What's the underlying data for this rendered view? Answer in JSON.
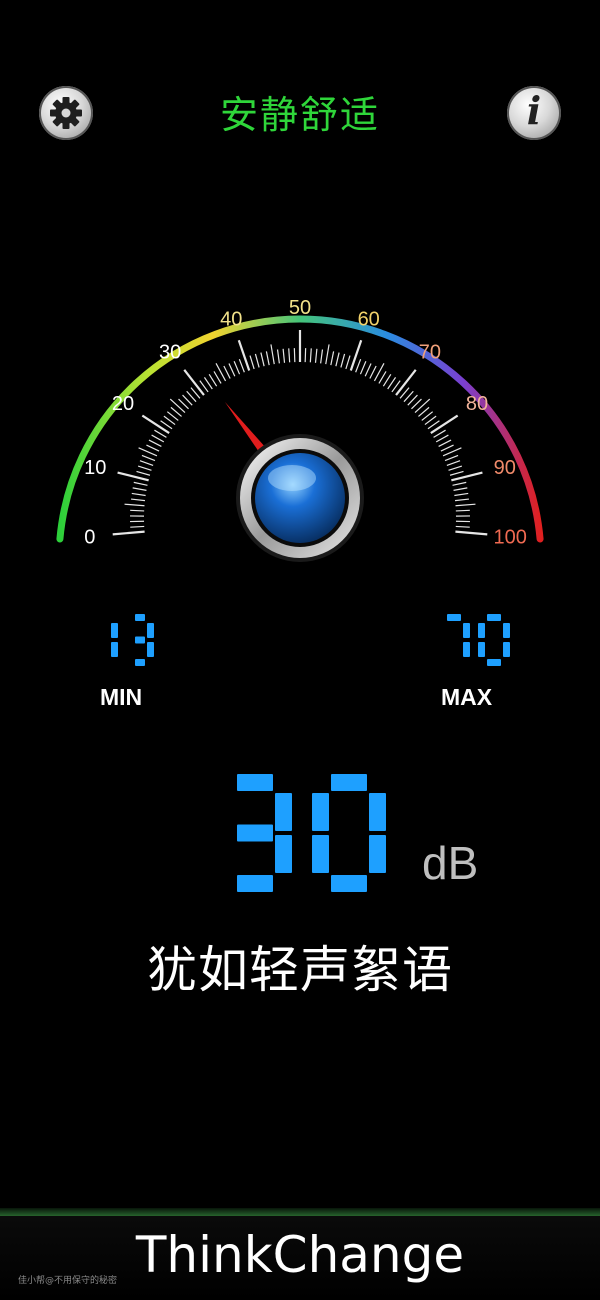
{
  "header": {
    "title": "安静舒适",
    "settings_icon": "gear-icon",
    "info_icon": "info-icon",
    "info_glyph": "i",
    "title_color": "#2fd63a"
  },
  "gauge": {
    "ticks": [
      "0",
      "10",
      "20",
      "30",
      "40",
      "50",
      "60",
      "70",
      "80",
      "90",
      "100"
    ],
    "range": [
      0,
      100
    ],
    "needle_value": 30,
    "needle_color": "#e11d1d",
    "hub_color": "#1a6fd6"
  },
  "readouts": {
    "min_value": "13",
    "min_label": "MIN",
    "max_value": "70",
    "max_label": "MAX",
    "current_value": "30",
    "unit": "dB",
    "lcd_color": "#1ea0ff"
  },
  "description": "犹如轻声絮语",
  "footer": {
    "brand": "ThinkChange",
    "watermark": "佳小帮@不用保守的秘密"
  }
}
